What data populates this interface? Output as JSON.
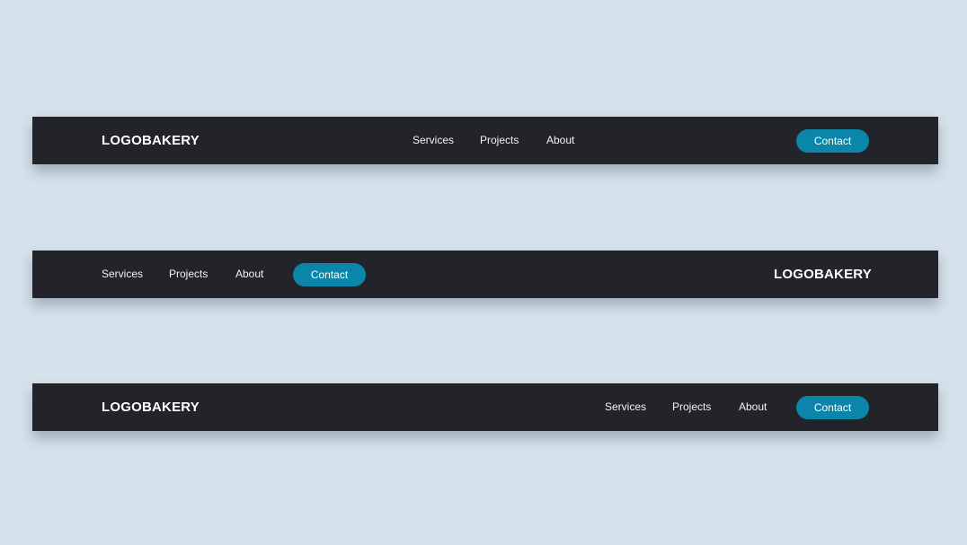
{
  "colors": {
    "background": "#d6e2eb",
    "navbar": "#222429",
    "accent": "#0b86a8",
    "text": "#ffffff"
  },
  "navbars": [
    {
      "logo": "LOGOBAKERY",
      "links": [
        "Services",
        "Projects",
        "About"
      ],
      "cta": "Contact"
    },
    {
      "logo": "LOGOBAKERY",
      "links": [
        "Services",
        "Projects",
        "About"
      ],
      "cta": "Contact"
    },
    {
      "logo": "LOGOBAKERY",
      "links": [
        "Services",
        "Projects",
        "About"
      ],
      "cta": "Contact"
    }
  ]
}
